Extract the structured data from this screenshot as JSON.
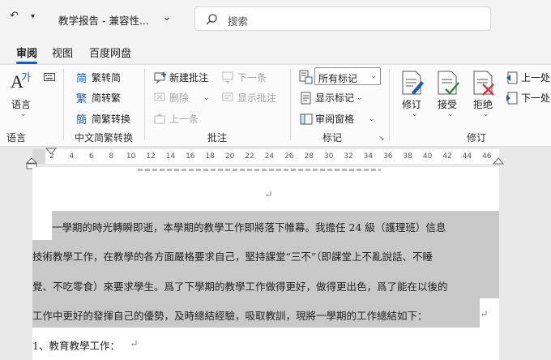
{
  "titlebar": {
    "doc_title": "教学报告 - 兼容性...",
    "search_placeholder": "搜索"
  },
  "tabs": {
    "review": "审阅",
    "view": "视图",
    "baidu": "百度网盘"
  },
  "ribbon": {
    "language": {
      "label_big": "语言",
      "group": "语言"
    },
    "chinese": {
      "to_traditional": "繁转简",
      "to_simplified": "简转繁",
      "convert": "简繁转换",
      "group": "中文简繁转换"
    },
    "comments": {
      "new": "新建批注",
      "delete": "删除",
      "previous": "上一条",
      "next": "下一条",
      "show": "显示批注",
      "group": "批注"
    },
    "tracking": {
      "markup_value": "所有标记",
      "show_markup": "显示标记",
      "review_pane": "审阅窗格",
      "group": "标记"
    },
    "changes": {
      "track": "修订",
      "accept": "接受",
      "reject": "拒绝",
      "previous": "上一处",
      "next": "下一处",
      "group": "修订"
    }
  },
  "ruler": {
    "marks": [
      "2",
      "4",
      "6",
      "8",
      "10",
      "12",
      "14",
      "16",
      "18",
      "20",
      "22",
      "24",
      "26",
      "28",
      "30",
      "32",
      "34",
      "36",
      "38",
      "40",
      "42",
      "44",
      "46"
    ]
  },
  "document": {
    "line1": "一學期的時光轉瞬即逝，本學期的教學工作即將落下帷幕。我擔任 24 級（護理班）信息",
    "line2": "技術教學工作，在教學的各方面嚴格要求自己，堅持課堂“三不”（即課堂上不亂說話、不睡",
    "line3": "覺、不吃零食）來要求學生。爲了下學期的教學工作做得更好，做得更出色，爲了能在以後的",
    "line4": "工作中更好的發揮自己的優勢，及時總結經驗，吸取教訓，現將一學期的工作總結如下：",
    "line5": "1、教育教學工作：",
    "return_mark": "↵"
  }
}
